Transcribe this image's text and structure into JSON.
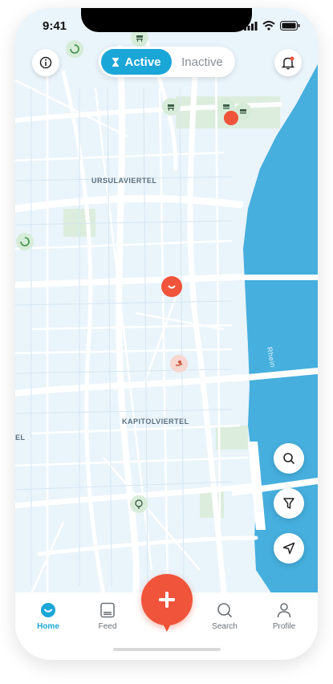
{
  "status": {
    "time": "9:41"
  },
  "toggle": {
    "active_label": "Active",
    "inactive_label": "Inactive"
  },
  "map": {
    "labels": {
      "north": "URSULAVIERTEL",
      "center": "KAPITOLVIERTEL",
      "west": "EL",
      "river": "Rhein"
    },
    "colors": {
      "water": "#46afde",
      "land": "#eaf4fb",
      "road": "#ffffff",
      "park": "#dcedde"
    }
  },
  "icons": {
    "info": "info-icon",
    "bell": "bell-notification-icon",
    "search": "search-icon",
    "filter": "filter-icon",
    "locate": "navigation-arrow-icon",
    "add": "plus-icon"
  },
  "tabs": [
    {
      "label": "Home",
      "icon": "home-icon",
      "active": true
    },
    {
      "label": "Feed",
      "icon": "feed-icon",
      "active": false
    },
    {
      "label": "Search",
      "icon": "search-icon",
      "active": false
    },
    {
      "label": "Profile",
      "icon": "profile-icon",
      "active": false
    }
  ],
  "accent": "#1ba6d8",
  "brand": "#f0543a"
}
